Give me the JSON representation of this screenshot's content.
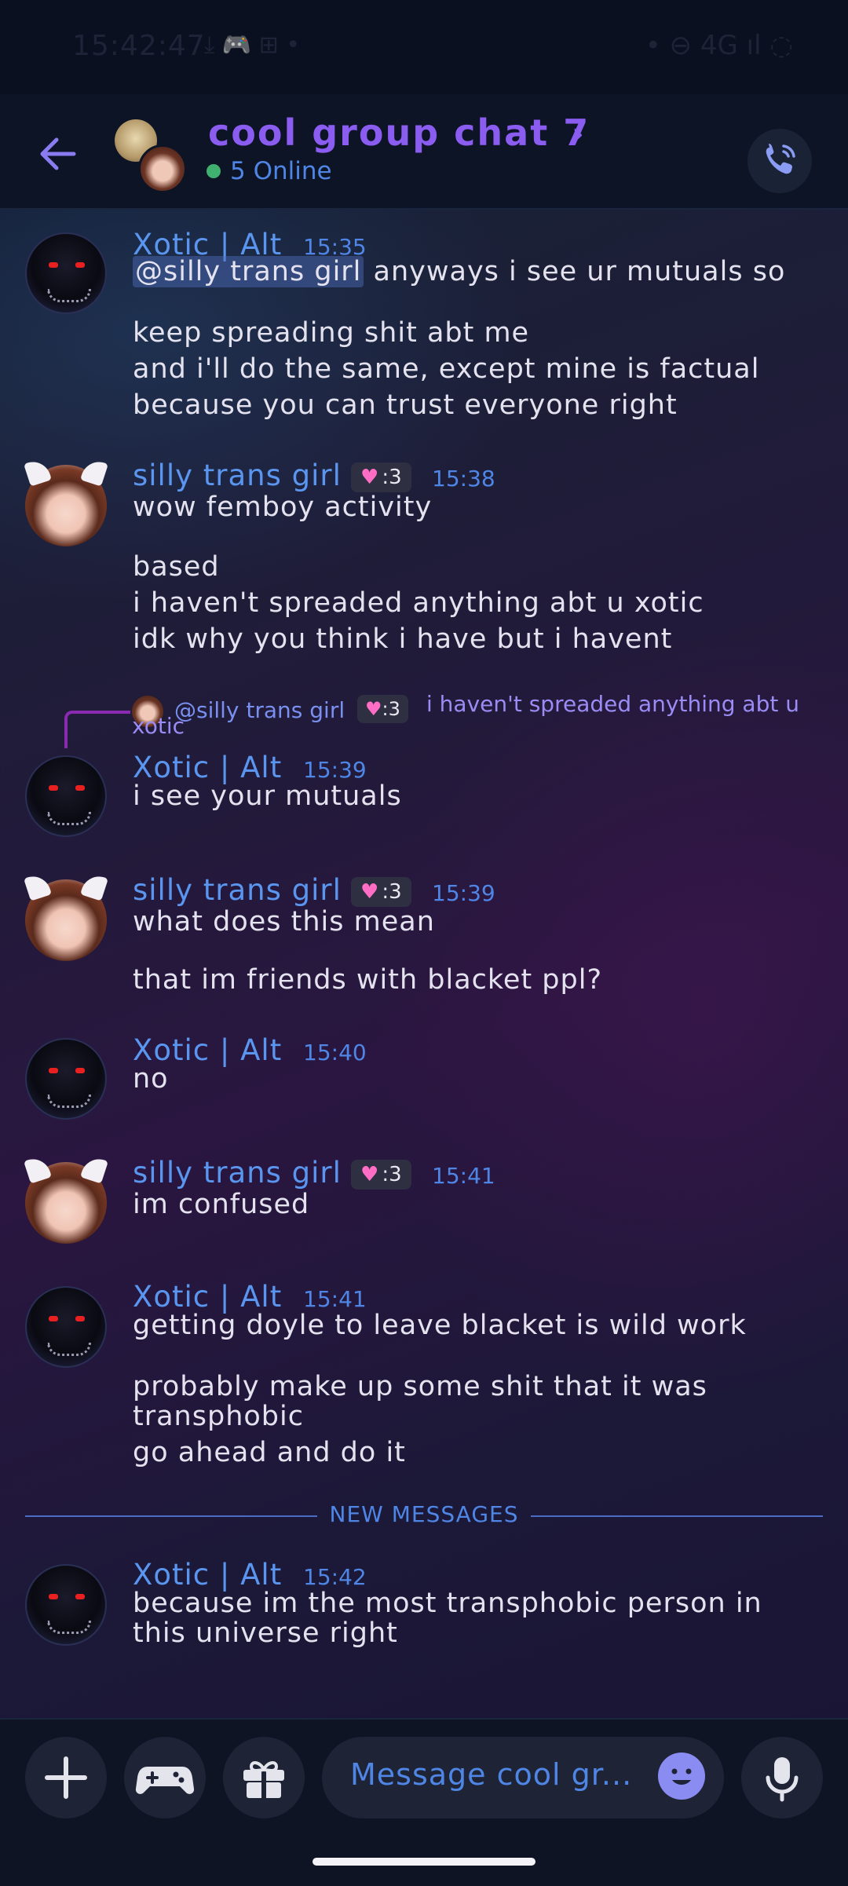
{
  "status_bar": {
    "time": "15:42:47",
    "icons_left": "⤓ 🎮 ⊞ •",
    "icons_right": "• ⊖ 4G ıl ◌"
  },
  "header": {
    "back_icon": "arrow-left-icon",
    "title": "cool group chat 7",
    "chevron": "›",
    "online_text": "5 Online",
    "call_icon": "phone-call-icon",
    "accent_color": "#8a5cf0"
  },
  "messages": [
    {
      "author": "Xotic | Alt",
      "time": "15:35",
      "mention": "@silly trans girl",
      "line1_rest": " anyways i see ur mutuals so",
      "lines": [
        "keep spreading shit abt me",
        "and i'll do the same, except mine is factual",
        "because you can trust everyone right"
      ]
    },
    {
      "author": "silly trans girl",
      "badge": ":3",
      "time": "15:38",
      "lines": [
        "wow femboy activity",
        "based",
        "i haven't spreaded anything abt u xotic",
        "idk why you think i have but i havent"
      ]
    },
    {
      "reply": {
        "author": "@silly trans girl",
        "badge": ":3",
        "text": "i haven't spreaded anything abt u",
        "text_wrap": "xotic"
      },
      "author": "Xotic | Alt",
      "time": "15:39",
      "lines": [
        "i see your mutuals"
      ]
    },
    {
      "author": "silly trans girl",
      "badge": ":3",
      "time": "15:39",
      "lines": [
        "what does this mean",
        "that im friends with blacket ppl?"
      ]
    },
    {
      "author": "Xotic | Alt",
      "time": "15:40",
      "lines": [
        "no"
      ]
    },
    {
      "author": "silly trans girl",
      "badge": ":3",
      "time": "15:41",
      "lines": [
        "im confused"
      ]
    },
    {
      "author": "Xotic | Alt",
      "time": "15:41",
      "lines": [
        "getting doyle to leave blacket is wild work",
        "probably make up some shit that it was",
        "transphobic",
        "go ahead and do it"
      ]
    },
    {
      "author": "Xotic | Alt",
      "time": "15:42",
      "lines": [
        "because im the most transphobic person in",
        "this universe right"
      ]
    }
  ],
  "divider_label": "NEW MESSAGES",
  "input": {
    "placeholder": "Message cool gr...",
    "buttons": [
      "plus-icon",
      "gamepad-icon",
      "gift-icon",
      "emoji-icon",
      "microphone-icon"
    ]
  }
}
